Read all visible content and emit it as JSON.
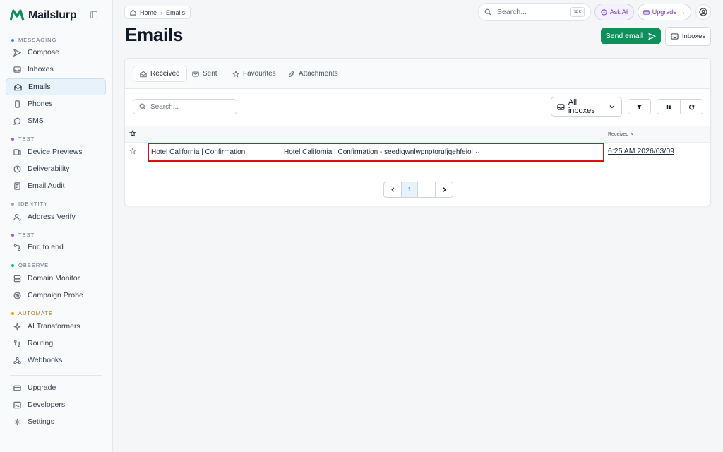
{
  "app": {
    "name": "Mailslurp",
    "brand_color": "#0f8f5c"
  },
  "sidebar": {
    "sections": [
      {
        "label": "MESSAGING",
        "dot_color": "#3b82f6"
      },
      {
        "label": "TEST",
        "dot_color": "#8b5cf6"
      },
      {
        "label": "IDENTITY",
        "dot_color": "#9ca3af"
      },
      {
        "label": "TEST",
        "dot_color": "#8b5cf6"
      },
      {
        "label": "OBSERVE",
        "dot_color": "#10b981"
      },
      {
        "label": "AUTOMATE",
        "dot_color": "#f59e0b"
      }
    ],
    "items": [
      {
        "label": "Compose",
        "icon": "send-icon"
      },
      {
        "label": "Inboxes",
        "icon": "inbox-icon"
      },
      {
        "label": "Emails",
        "icon": "mail-open-icon",
        "active": true
      },
      {
        "label": "Phones",
        "icon": "phone-icon"
      },
      {
        "label": "SMS",
        "icon": "chat-icon"
      },
      {
        "label": "Device Previews",
        "icon": "devices-icon"
      },
      {
        "label": "Deliverability",
        "icon": "clock-icon"
      },
      {
        "label": "Email Audit",
        "icon": "audit-icon"
      },
      {
        "label": "Address Verify",
        "icon": "user-check-icon"
      },
      {
        "label": "End to end",
        "icon": "flow-icon"
      },
      {
        "label": "Domain Monitor",
        "icon": "server-icon"
      },
      {
        "label": "Campaign Probe",
        "icon": "probe-icon"
      },
      {
        "label": "AI Transformers",
        "icon": "sparkle-icon"
      },
      {
        "label": "Routing",
        "icon": "route-icon"
      },
      {
        "label": "Webhooks",
        "icon": "webhook-icon"
      }
    ],
    "footer_items": [
      {
        "label": "Upgrade",
        "icon": "card-icon"
      },
      {
        "label": "Developers",
        "icon": "terminal-icon"
      },
      {
        "label": "Settings",
        "icon": "gear-icon"
      }
    ]
  },
  "breadcrumb": {
    "home": "Home",
    "current": "Emails"
  },
  "topbar": {
    "search_placeholder": "Search...",
    "search_shortcut": "⌘K",
    "ask_ai": "Ask AI",
    "upgrade": "Upgrade"
  },
  "page": {
    "title": "Emails",
    "send_email": "Send email",
    "inboxes": "Inboxes"
  },
  "tabs": [
    {
      "label": "Received",
      "active": true
    },
    {
      "label": "Sent"
    },
    {
      "label": "Favourites"
    },
    {
      "label": "Attachments"
    }
  ],
  "list": {
    "search_placeholder": "Search...",
    "inbox_filter": "All inboxes",
    "column_received": "Received",
    "rows": [
      {
        "sender": "Hotel California | Confirmation",
        "subject": "Hotel California | Confirmation - seediqwnlwpnptorufjqehfeiol···",
        "received": "6:25 AM 2026/03/09"
      }
    ]
  },
  "pagination": {
    "current": "1",
    "ellipsis": "..."
  }
}
